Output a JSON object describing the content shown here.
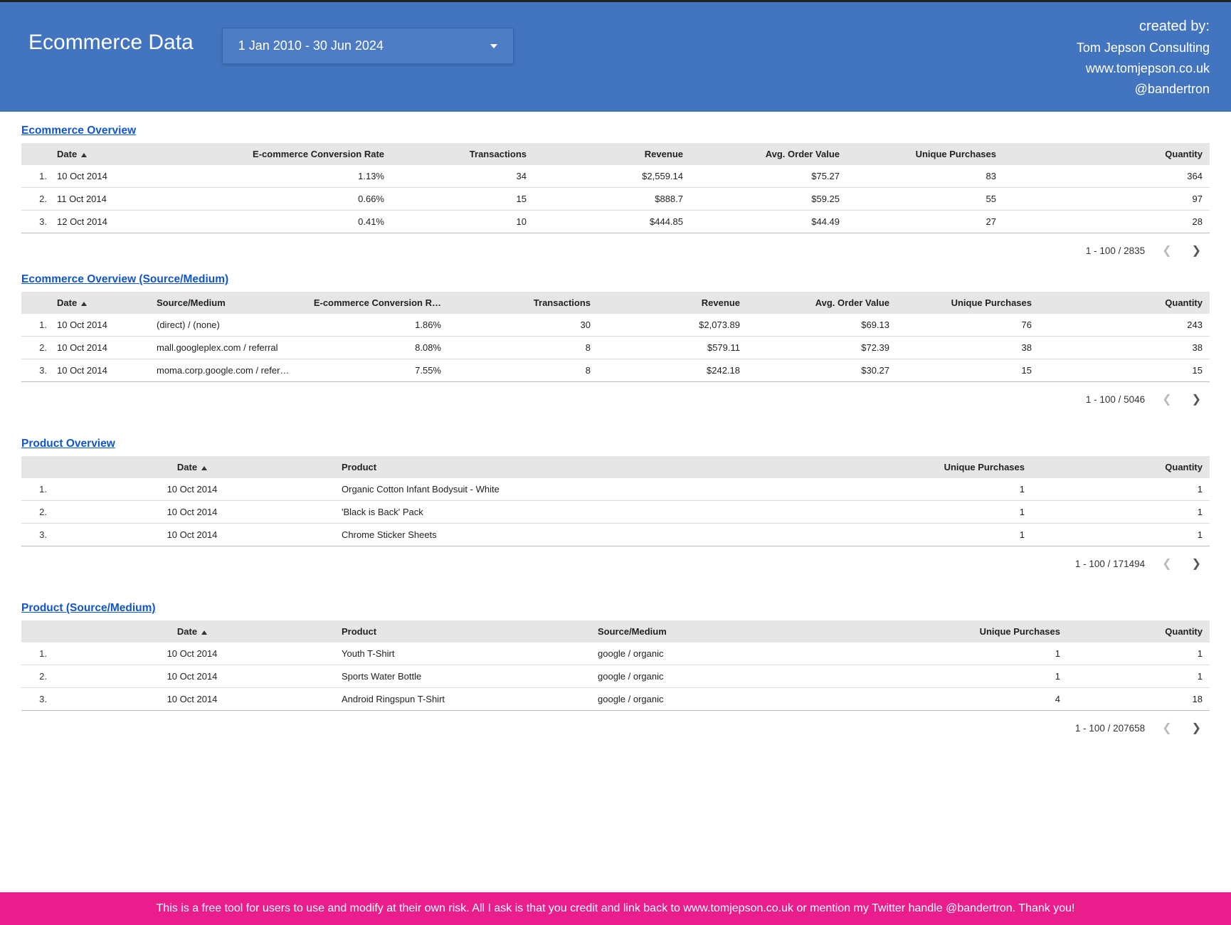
{
  "header": {
    "title": "Ecommerce Data",
    "date_range": "1 Jan 2010 - 30 Jun 2024",
    "created_by_label": "created by:",
    "company": "Tom Jepson Consulting",
    "site": "www.tomjepson.co.uk",
    "twitter": "@bandertron"
  },
  "sections": {
    "overview": {
      "title": "Ecommerce Overview",
      "columns": {
        "date": "Date",
        "conv": "E-commerce Conversion Rate",
        "trans": "Transactions",
        "rev": "Revenue",
        "aov": "Avg. Order Value",
        "uniq": "Unique Purchases",
        "qty": "Quantity"
      },
      "rows": [
        {
          "idx": "1.",
          "date": "10 Oct 2014",
          "conv": "1.13%",
          "trans": "34",
          "rev": "$2,559.14",
          "aov": "$75.27",
          "uniq": "83",
          "qty": "364"
        },
        {
          "idx": "2.",
          "date": "11 Oct 2014",
          "conv": "0.66%",
          "trans": "15",
          "rev": "$888.7",
          "aov": "$59.25",
          "uniq": "55",
          "qty": "97"
        },
        {
          "idx": "3.",
          "date": "12 Oct 2014",
          "conv": "0.41%",
          "trans": "10",
          "rev": "$444.85",
          "aov": "$44.49",
          "uniq": "27",
          "qty": "28"
        }
      ],
      "pager": "1 - 100 / 2835"
    },
    "overview_sm": {
      "title": "Ecommerce Overview (Source/Medium)",
      "columns": {
        "date": "Date",
        "sm": "Source/Medium",
        "conv": "E-commerce Conversion R…",
        "trans": "Transactions",
        "rev": "Revenue",
        "aov": "Avg. Order Value",
        "uniq": "Unique Purchases",
        "qty": "Quantity"
      },
      "rows": [
        {
          "idx": "1.",
          "date": "10 Oct 2014",
          "sm": "(direct) / (none)",
          "conv": "1.86%",
          "trans": "30",
          "rev": "$2,073.89",
          "aov": "$69.13",
          "uniq": "76",
          "qty": "243"
        },
        {
          "idx": "2.",
          "date": "10 Oct 2014",
          "sm": "mall.googleplex.com / referral",
          "conv": "8.08%",
          "trans": "8",
          "rev": "$579.11",
          "aov": "$72.39",
          "uniq": "38",
          "qty": "38"
        },
        {
          "idx": "3.",
          "date": "10 Oct 2014",
          "sm": "moma.corp.google.com / refer…",
          "conv": "7.55%",
          "trans": "8",
          "rev": "$242.18",
          "aov": "$30.27",
          "uniq": "15",
          "qty": "15"
        }
      ],
      "pager": "1 - 100 / 5046"
    },
    "product": {
      "title": "Product Overview",
      "columns": {
        "date": "Date",
        "product": "Product",
        "uniq": "Unique Purchases",
        "qty": "Quantity"
      },
      "rows": [
        {
          "idx": "1.",
          "date": "10 Oct 2014",
          "product": "Organic Cotton Infant Bodysuit - White",
          "uniq": "1",
          "qty": "1"
        },
        {
          "idx": "2.",
          "date": "10 Oct 2014",
          "product": "'Black is Back' Pack",
          "uniq": "1",
          "qty": "1"
        },
        {
          "idx": "3.",
          "date": "10 Oct 2014",
          "product": "Chrome Sticker Sheets",
          "uniq": "1",
          "qty": "1"
        }
      ],
      "pager": "1 - 100 / 171494"
    },
    "product_sm": {
      "title": "Product (Source/Medium)",
      "columns": {
        "date": "Date",
        "product": "Product",
        "sm": "Source/Medium",
        "uniq": "Unique Purchases",
        "qty": "Quantity"
      },
      "rows": [
        {
          "idx": "1.",
          "date": "10 Oct 2014",
          "product": "Youth T-Shirt",
          "sm": "google / organic",
          "uniq": "1",
          "qty": "1"
        },
        {
          "idx": "2.",
          "date": "10 Oct 2014",
          "product": "Sports Water Bottle",
          "sm": "google / organic",
          "uniq": "1",
          "qty": "1"
        },
        {
          "idx": "3.",
          "date": "10 Oct 2014",
          "product": "Android Ringspun T-Shirt",
          "sm": "google / organic",
          "uniq": "4",
          "qty": "18"
        }
      ],
      "pager": "1 - 100 / 207658"
    }
  },
  "footer": {
    "text": "This is a free tool for users to use and modify at their own risk. All I ask is that you credit and link back to www.tomjepson.co.uk or mention my Twitter handle @bandertron. Thank you!"
  }
}
